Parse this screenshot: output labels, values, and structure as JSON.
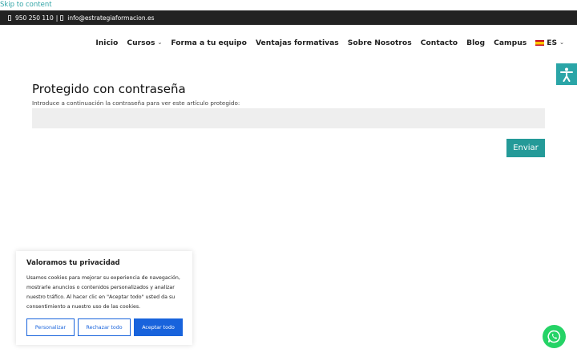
{
  "skip_link": "Skip to content",
  "topbar": {
    "phone": "950 250 110",
    "separator": "|",
    "email": "info@estrategiaformacion.es"
  },
  "nav": {
    "items": [
      {
        "label": "Inicio"
      },
      {
        "label": "Cursos"
      },
      {
        "label": "Forma a tu equipo"
      },
      {
        "label": "Ventajas formativas"
      },
      {
        "label": "Sobre Nosotros"
      },
      {
        "label": "Contacto"
      },
      {
        "label": "Blog"
      },
      {
        "label": "Campus"
      },
      {
        "label": "ES"
      }
    ]
  },
  "main": {
    "title": "Protegido con contraseña",
    "instruction": "Introduce a continuación la contraseña para ver este artículo protegido:",
    "password_value": "",
    "submit_label": "Enviar"
  },
  "cookie": {
    "title": "Valoramos tu privacidad",
    "text": "Usamos cookies para mejorar su experiencia de navegación, mostrarle anuncios o contenidos personalizados y analizar nuestro tráfico. Al hacer clic en \"Aceptar todo\" usted da su consentimiento a nuestro uso de las cookies.",
    "customize_label": "Personalizar",
    "reject_label": "Rechazar todo",
    "accept_label": "Aceptar todo"
  },
  "icons": {
    "phone": "phone-icon",
    "email": "email-icon",
    "accessibility": "accessibility-icon",
    "whatsapp": "whatsapp-icon",
    "language_flag": "spain-flag-icon"
  },
  "colors": {
    "accent": "#249a98",
    "topbar": "#222222",
    "cookie_blue": "#1863dc",
    "whatsapp": "#25d366"
  }
}
